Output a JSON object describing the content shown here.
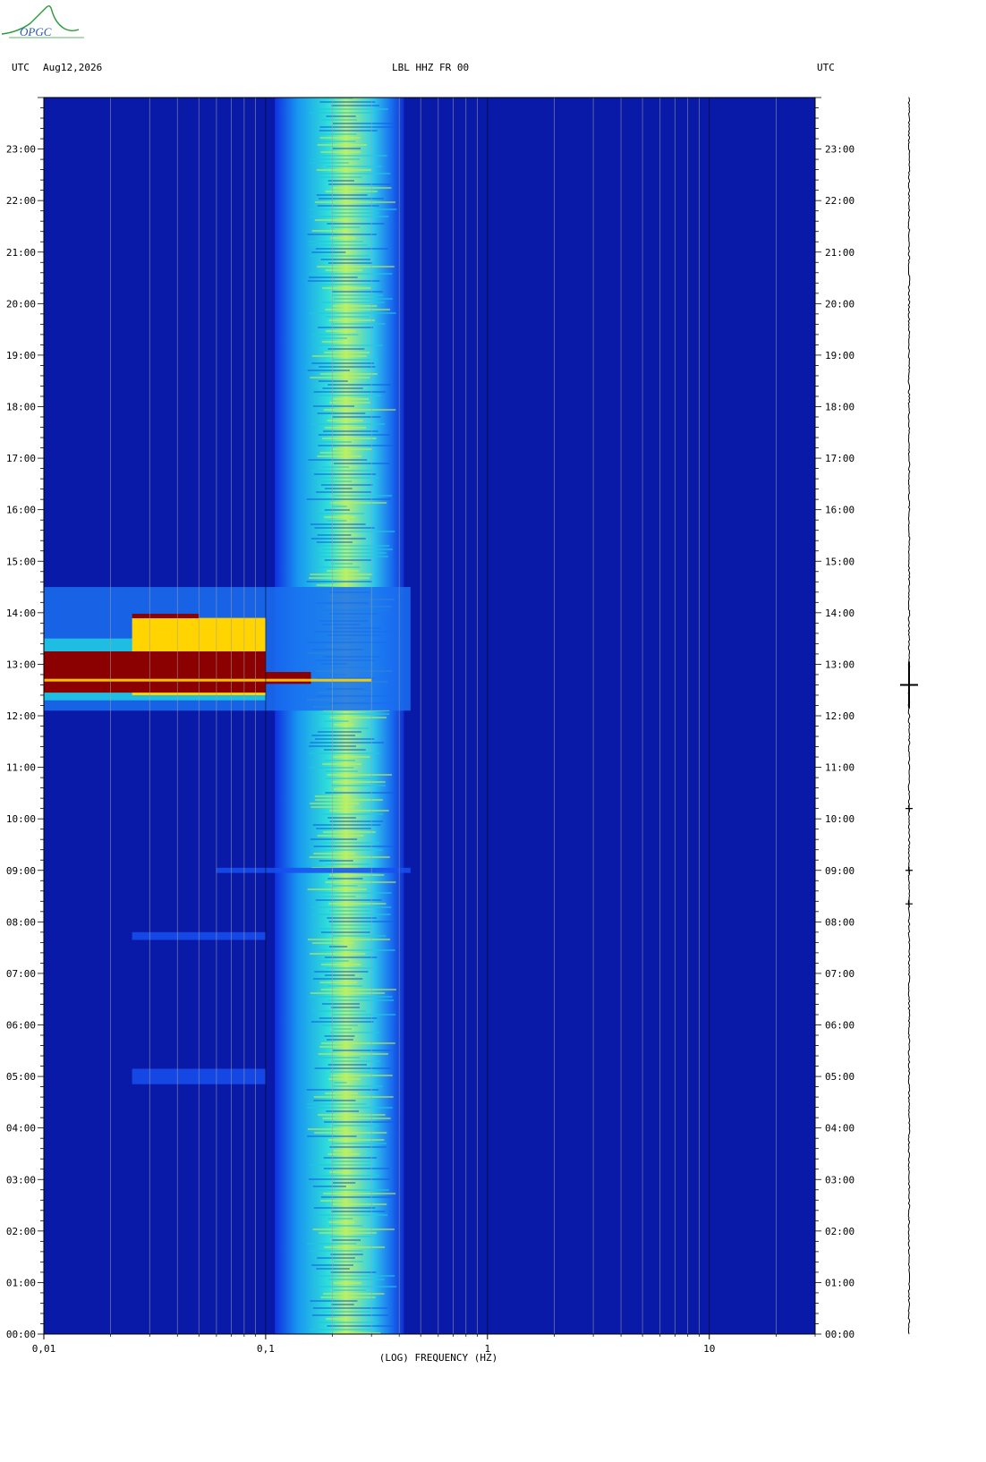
{
  "header": {
    "left_tz": "UTC",
    "date": "Aug12,2026",
    "station": "LBL HHZ FR 00",
    "right_tz": "UTC"
  },
  "logo_text": "OPGC",
  "icons": {
    "logo": "opgc-logo-icon"
  },
  "chart_data": {
    "type": "heatmap",
    "title": "LBL HHZ FR 00",
    "xlabel": "(LOG) FREQUENCY (HZ)",
    "ylabel": "",
    "x_scale": "log",
    "xlim": [
      0.01,
      30
    ],
    "x_ticks": [
      {
        "value": 0.01,
        "label": "0,01"
      },
      {
        "value": 0.1,
        "label": "0,1"
      },
      {
        "value": 1,
        "label": "1"
      },
      {
        "value": 10,
        "label": "10"
      }
    ],
    "y_ticks": [
      "00:00",
      "01:00",
      "02:00",
      "03:00",
      "04:00",
      "05:00",
      "06:00",
      "07:00",
      "08:00",
      "09:00",
      "10:00",
      "11:00",
      "12:00",
      "13:00",
      "14:00",
      "15:00",
      "16:00",
      "17:00",
      "18:00",
      "19:00",
      "20:00",
      "21:00",
      "22:00",
      "23:00"
    ],
    "ylim_hours": [
      0,
      24
    ],
    "grid": true,
    "colors": {
      "background": "#0a1aa8",
      "microseism_band": "#1fc8e0",
      "microseism_peak": "#c8f040",
      "event": "#8b0000",
      "event_edge": "#ffd400"
    },
    "microseism_band_hz": [
      0.11,
      0.42
    ],
    "microseism_peak_hz": [
      0.17,
      0.27
    ],
    "events": [
      {
        "time_start_h": 12.1,
        "time_end_h": 14.5,
        "freq_lo_hz": 0.01,
        "freq_hi_hz": 0.45,
        "peak_time_h": 12.7
      },
      {
        "time_start_h": 4.85,
        "time_end_h": 5.15,
        "freq_lo_hz": 0.025,
        "freq_hi_hz": 0.1
      },
      {
        "time_start_h": 7.65,
        "time_end_h": 7.8,
        "freq_lo_hz": 0.025,
        "freq_hi_hz": 0.1
      },
      {
        "time_start_h": 8.95,
        "time_end_h": 9.05,
        "freq_lo_hz": 0.06,
        "freq_hi_hz": 0.45
      }
    ],
    "trace_spikes_h": [
      12.6,
      9.0,
      8.35,
      10.2
    ]
  }
}
